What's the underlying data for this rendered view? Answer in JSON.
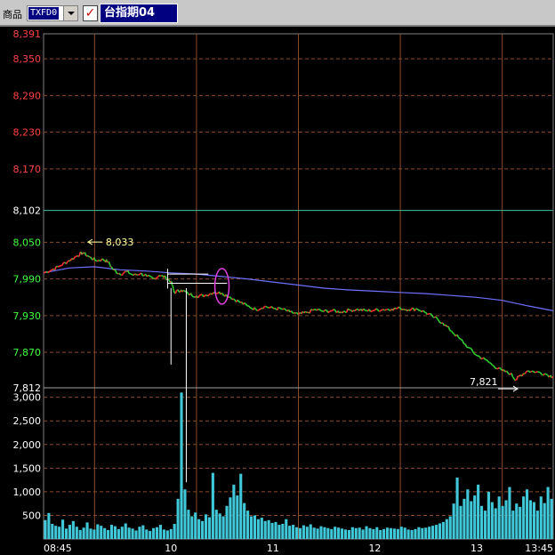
{
  "toolbar": {
    "label": "商品",
    "symbol_value": "TXFD0",
    "title": "台指期04"
  },
  "chart_data": [
    {
      "type": "line",
      "title": "",
      "ylim": [
        7812,
        8391
      ],
      "y_ticks_red": [
        "8,391",
        "8,350",
        "8,290",
        "8,230",
        "8,170"
      ],
      "y_ticks_green": [
        "8,050",
        "7,990",
        "7,930",
        "7,870"
      ],
      "y_ticks_white": [
        "8,102",
        "7,812"
      ],
      "reference_level": 8102,
      "x_ticks": [
        "08:45",
        "10",
        "11",
        "12",
        "13",
        "13:45"
      ],
      "x_tick_times": [
        525,
        600,
        660,
        720,
        780,
        825
      ],
      "annotations": [
        "8,033",
        "7,821"
      ],
      "series": [
        {
          "values_hint": "price",
          "points": [
            [
              525,
              8000
            ],
            [
              530,
              8005
            ],
            [
              535,
              8012
            ],
            [
              540,
              8020
            ],
            [
              545,
              8028
            ],
            [
              548,
              8033
            ],
            [
              552,
              8026
            ],
            [
              556,
              8020
            ],
            [
              560,
              8022
            ],
            [
              563,
              8018
            ],
            [
              566,
              8005
            ],
            [
              570,
              7998
            ],
            [
              574,
              8002
            ],
            [
              578,
              7996
            ],
            [
              582,
              7999
            ],
            [
              586,
              7994
            ],
            [
              590,
              7990
            ],
            [
              593,
              7996
            ],
            [
              597,
              7992
            ],
            [
              600,
              7986
            ],
            [
              602,
              7968
            ],
            [
              606,
              7972
            ],
            [
              610,
              7966
            ],
            [
              615,
              7962
            ],
            [
              620,
              7963
            ],
            [
              625,
              7968
            ],
            [
              630,
              7967
            ],
            [
              635,
              7960
            ],
            [
              640,
              7953
            ],
            [
              645,
              7946
            ],
            [
              650,
              7940
            ],
            [
              655,
              7945
            ],
            [
              660,
              7942
            ],
            [
              665,
              7941
            ],
            [
              670,
              7936
            ],
            [
              675,
              7932
            ],
            [
              680,
              7935
            ],
            [
              685,
              7940
            ],
            [
              690,
              7937
            ],
            [
              695,
              7938
            ],
            [
              700,
              7936
            ],
            [
              705,
              7939
            ],
            [
              710,
              7940
            ],
            [
              715,
              7938
            ],
            [
              720,
              7939
            ],
            [
              725,
              7940
            ],
            [
              730,
              7941
            ],
            [
              735,
              7942
            ],
            [
              740,
              7940
            ],
            [
              745,
              7941
            ],
            [
              750,
              7935
            ],
            [
              755,
              7927
            ],
            [
              760,
              7918
            ],
            [
              765,
              7905
            ],
            [
              770,
              7892
            ],
            [
              775,
              7878
            ],
            [
              780,
              7865
            ],
            [
              785,
              7858
            ],
            [
              790,
              7848
            ],
            [
              795,
              7840
            ],
            [
              800,
              7835
            ],
            [
              803,
              7825
            ],
            [
              805,
              7831
            ],
            [
              810,
              7840
            ],
            [
              815,
              7838
            ],
            [
              820,
              7835
            ],
            [
              825,
              7830
            ]
          ]
        },
        {
          "values_hint": "average",
          "points": [
            [
              525,
              8000
            ],
            [
              540,
              8008
            ],
            [
              555,
              8010
            ],
            [
              570,
              8005
            ],
            [
              585,
              8003
            ],
            [
              600,
              8000
            ],
            [
              615,
              7998
            ],
            [
              630,
              7994
            ],
            [
              645,
              7990
            ],
            [
              660,
              7985
            ],
            [
              675,
              7980
            ],
            [
              690,
              7975
            ],
            [
              705,
              7972
            ],
            [
              720,
              7970
            ],
            [
              735,
              7968
            ],
            [
              750,
              7966
            ],
            [
              765,
              7963
            ],
            [
              780,
              7960
            ],
            [
              795,
              7955
            ],
            [
              810,
              7946
            ],
            [
              825,
              7938
            ]
          ]
        }
      ]
    },
    {
      "type": "bar",
      "title": "",
      "ylim": [
        0,
        3200
      ],
      "y_ticks": [
        "3,000",
        "2,500",
        "2,000",
        "1,500",
        "1,000",
        "500"
      ],
      "volume": [
        400,
        550,
        320,
        280,
        260,
        410,
        220,
        300,
        380,
        260,
        190,
        240,
        350,
        220,
        200,
        310,
        280,
        230,
        190,
        300,
        270,
        210,
        260,
        330,
        240,
        220,
        180,
        260,
        290,
        200,
        170,
        230,
        250,
        300,
        200,
        180,
        210,
        320,
        850,
        3100,
        1050,
        620,
        480,
        560,
        420,
        380,
        520,
        460,
        1400,
        620,
        540,
        480,
        700,
        880,
        1150,
        920,
        1380,
        760,
        600,
        480,
        500,
        420,
        450,
        380,
        400,
        340,
        360,
        300,
        320,
        420,
        280,
        300,
        250,
        230,
        290,
        260,
        310,
        240,
        220,
        270,
        250,
        230,
        210,
        260,
        240,
        220,
        200,
        190,
        250,
        230,
        240,
        200,
        270,
        230,
        210,
        250,
        190,
        210,
        240,
        230,
        220,
        210,
        260,
        240,
        200,
        190,
        210,
        250,
        230,
        240,
        260,
        280,
        300,
        330,
        360,
        420,
        480,
        750,
        1300,
        700,
        850,
        1050,
        800,
        920,
        1150,
        700,
        600,
        1000,
        780,
        650,
        900,
        700,
        820,
        1100,
        600,
        750,
        680,
        900,
        1050,
        820,
        780,
        600,
        900,
        760,
        1100,
        850
      ]
    }
  ]
}
